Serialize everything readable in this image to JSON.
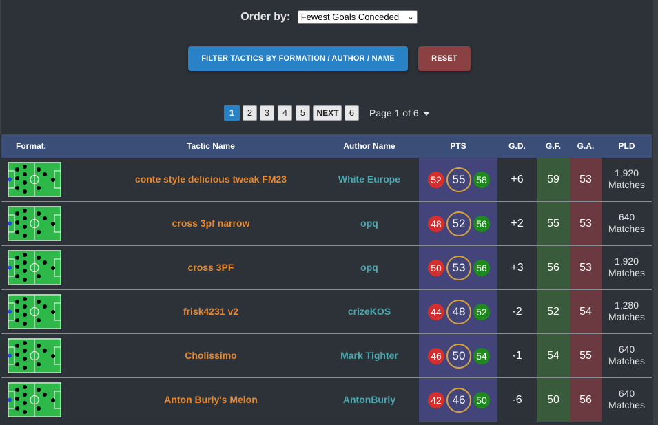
{
  "order": {
    "label": "Order by:",
    "selected": "Fewest Goals Conceded"
  },
  "buttons": {
    "filter_label": "FILTER TACTICS BY FORMATION / AUTHOR / NAME",
    "reset_label": "RESET"
  },
  "pagination": {
    "pages": [
      "1",
      "2",
      "3",
      "4",
      "5"
    ],
    "next_label": "NEXT",
    "last_page": "6",
    "active": "1",
    "info": "Page 1 of 6"
  },
  "table": {
    "headers": {
      "formation": "Format.",
      "name": "Tactic Name",
      "author": "Author Name",
      "pts": "PTS",
      "gd": "G.D.",
      "gf": "G.F.",
      "ga": "G.A.",
      "pld": "PLD"
    },
    "rows": [
      {
        "name": "conte style delicious tweak FM23",
        "author": "White Europe",
        "pts_min": "52",
        "pts": "55",
        "pts_max": "58",
        "gd": "+6",
        "gf": "59",
        "ga": "53",
        "pld": "1,920",
        "pld_unit": "Matches"
      },
      {
        "name": "cross 3pf narrow",
        "author": "opq",
        "pts_min": "48",
        "pts": "52",
        "pts_max": "56",
        "gd": "+2",
        "gf": "55",
        "ga": "53",
        "pld": "640",
        "pld_unit": "Matches"
      },
      {
        "name": "cross 3PF",
        "author": "opq",
        "pts_min": "50",
        "pts": "53",
        "pts_max": "56",
        "gd": "+3",
        "gf": "56",
        "ga": "53",
        "pld": "1,920",
        "pld_unit": "Matches"
      },
      {
        "name": "frisk4231 v2",
        "author": "crizeKOS",
        "pts_min": "44",
        "pts": "48",
        "pts_max": "52",
        "gd": "-2",
        "gf": "52",
        "ga": "54",
        "pld": "1,280",
        "pld_unit": "Matches"
      },
      {
        "name": "Cholissimo",
        "author": "Mark Tighter",
        "pts_min": "46",
        "pts": "50",
        "pts_max": "54",
        "gd": "-1",
        "gf": "54",
        "ga": "55",
        "pld": "640",
        "pld_unit": "Matches"
      },
      {
        "name": "Anton Burly's Melon",
        "author": "AntonBurly",
        "pts_min": "42",
        "pts": "46",
        "pts_max": "50",
        "gd": "-6",
        "gf": "50",
        "ga": "56",
        "pld": "640",
        "pld_unit": "Matches"
      }
    ]
  },
  "colors": {
    "background": "#2d3138",
    "header_bg": "#3a4e78",
    "filter_button": "#2a82c6",
    "reset_button": "#8b4042",
    "tactic_name": "#e58a36",
    "author_name": "#4aa8b0",
    "pts_column": "#42447a",
    "gf_column": "#3a5a3c",
    "ga_column": "#6a3a40",
    "pts_min_badge": "#d32f2f",
    "pts_max_badge": "#1e8a1e",
    "pts_ring": "#d9a53a",
    "pitch_green": "#2fb84a"
  }
}
